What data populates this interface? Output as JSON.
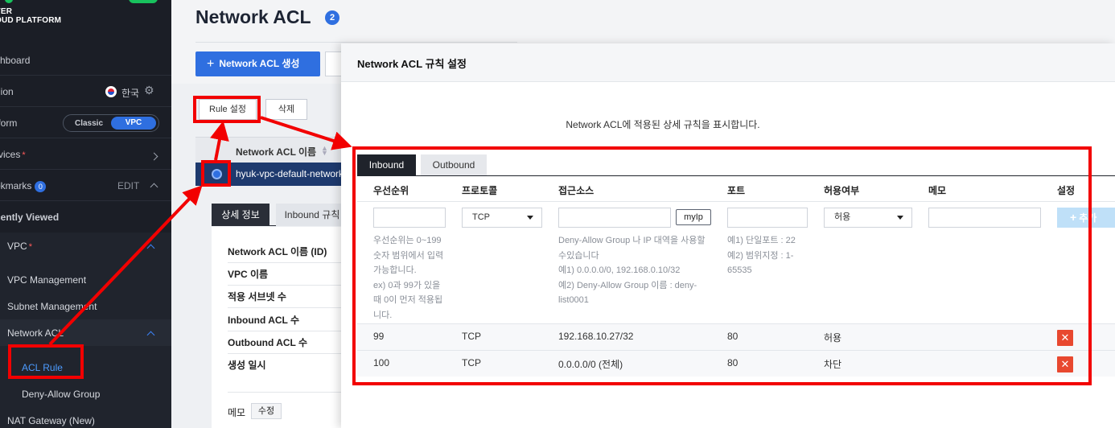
{
  "sidebar": {
    "brand_line1": "VER",
    "brand_line2": "OUD PLATFORM",
    "dashboard": "shboard",
    "region_label": "gion",
    "region_value": "한국",
    "platform_label": "tform",
    "platform_classic": "Classic",
    "platform_vpc": "VPC",
    "services": "rvices",
    "bookmarks": "okmarks",
    "bookmarks_count": "0",
    "bookmarks_edit": "EDIT",
    "recently_viewed": "cently Viewed",
    "vpc": "VPC",
    "vpc_management": "VPC Management",
    "subnet_management": "Subnet Management",
    "network_acl": "Network ACL",
    "acl_rule": "ACL Rule",
    "deny_allow_group": "Deny-Allow Group",
    "nat_gateway": "NAT Gateway (New)",
    "required_mark": "*"
  },
  "main": {
    "title": "Network ACL",
    "title_badge": "2",
    "create_button": "Network ACL 생성",
    "rule_button": "Rule 설정",
    "delete_button": "삭제",
    "column_name": "Network ACL 이름",
    "selected_row_name": "hyuk-vpc-default-network",
    "detail_tab_info": "상세 정보",
    "detail_tab_inbound": "Inbound 규칙",
    "detail_labels": [
      "Network ACL 이름 (ID)",
      "VPC 이름",
      "적용 서브넷 수",
      "Inbound ACL 수",
      "Outbound ACL 수",
      "생성 일시"
    ],
    "memo_label": "메모",
    "memo_edit": "수정"
  },
  "modal": {
    "title": "Network ACL 규칙 설정",
    "description": "Network ACL에 적용된 상세 규칙을 표시합니다.",
    "tabs": [
      "Inbound",
      "Outbound"
    ],
    "columns": [
      "우선순위",
      "프로토콜",
      "접근소스",
      "포트",
      "허용여부",
      "메모",
      "설정"
    ],
    "form": {
      "protocol_value": "TCP",
      "allow_value": "허용",
      "myip_button": "myIp",
      "add_button": "추가"
    },
    "help": {
      "priority": [
        "우선순위는 0~199",
        "숫자 범위에서 입력",
        "가능합니다.",
        "ex) 0과 99가 있을",
        "때 0이 먼저 적용됩",
        "니다."
      ],
      "source": [
        "Deny-Allow Group 나 IP 대역을 사용할",
        "수있습니다",
        "예1) 0.0.0.0/0, 192.168.0.10/32",
        "예2) Deny-Allow Group 이름 : deny-",
        "list0001"
      ],
      "port": [
        "예1) 단일포트 : 22",
        "예2) 범위지정 : 1-",
        "65535"
      ]
    },
    "rules": [
      {
        "priority": "99",
        "protocol": "TCP",
        "source": "192.168.10.27/32",
        "port": "80",
        "action": "허용",
        "delete": "✕"
      },
      {
        "priority": "100",
        "protocol": "TCP",
        "source": "0.0.0.0/0 (전체)",
        "port": "80",
        "action": "차단",
        "delete": "✕"
      }
    ]
  },
  "colors": {
    "accent": "#2f6fe0",
    "highlight": "#f20000",
    "delete": "#e8482f",
    "sidebar_bg": "#1b1e26"
  }
}
